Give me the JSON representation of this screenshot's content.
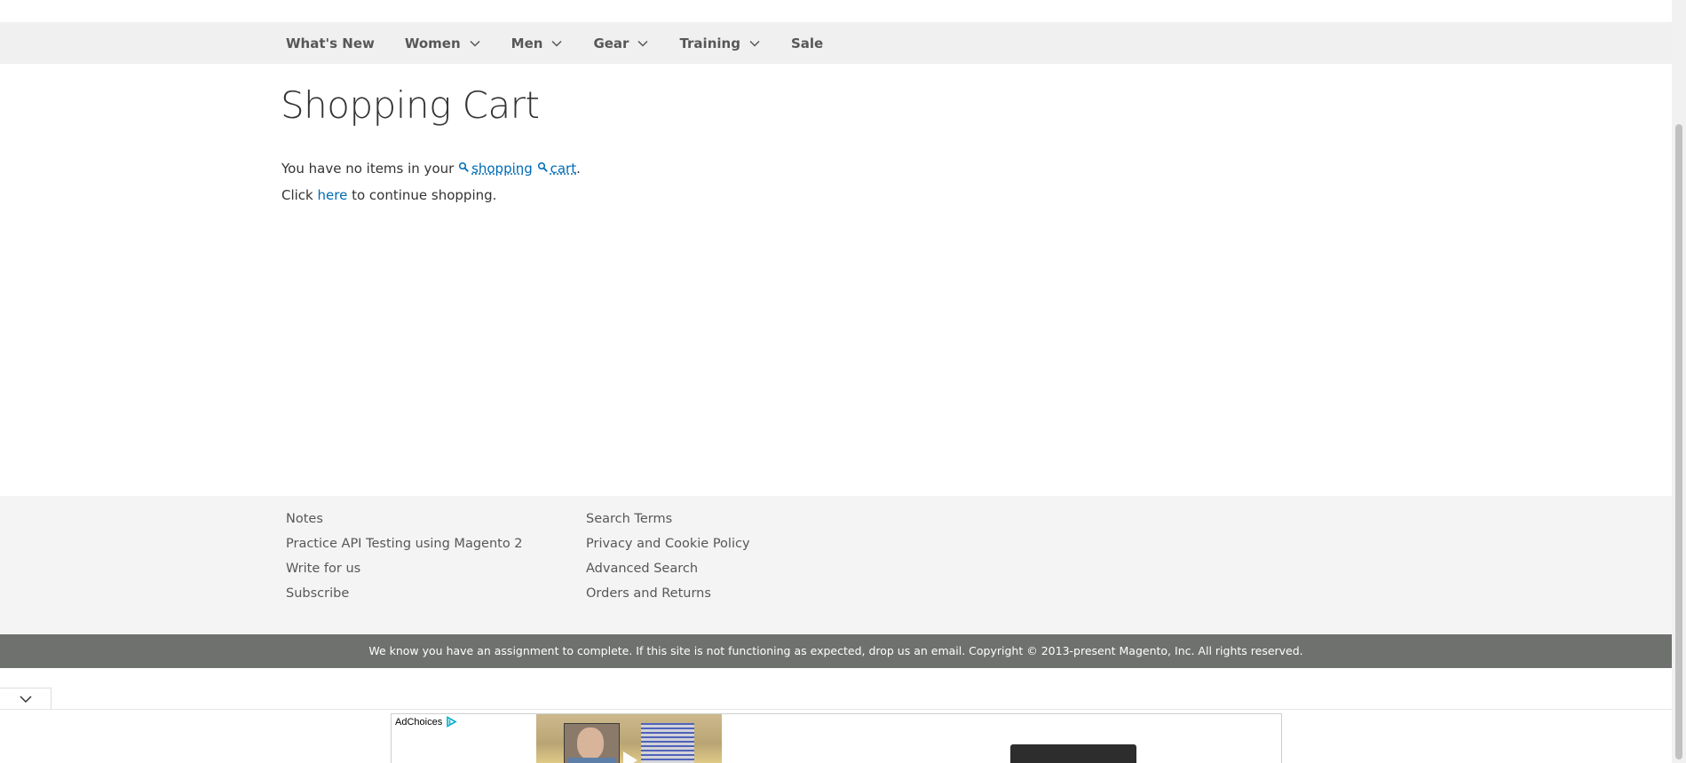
{
  "nav": {
    "items": [
      {
        "label": "What's New",
        "has_dropdown": false
      },
      {
        "label": "Women",
        "has_dropdown": true
      },
      {
        "label": "Men",
        "has_dropdown": true
      },
      {
        "label": "Gear",
        "has_dropdown": true
      },
      {
        "label": "Training",
        "has_dropdown": true
      },
      {
        "label": "Sale",
        "has_dropdown": false
      }
    ]
  },
  "main": {
    "title": "Shopping Cart",
    "empty_prefix": "You have no items in your ",
    "empty_word1": "shopping",
    "empty_word2": "cart",
    "empty_suffix": ".",
    "continue_prefix": "Click ",
    "continue_link": "here",
    "continue_suffix": " to continue shopping."
  },
  "footer": {
    "col1": [
      "Notes",
      "Practice API Testing using Magento 2",
      "Write for us",
      "Subscribe"
    ],
    "col2": [
      "Search Terms",
      "Privacy and Cookie Policy",
      "Advanced Search",
      "Orders and Returns"
    ],
    "copyright": "We know you have an assignment to complete. If this site is not functioning as expected, drop us an email. Copyright © 2013-present Magento, Inc. All rights reserved."
  },
  "ad": {
    "adchoices_label": "AdChoices"
  },
  "colors": {
    "link": "#006bb4",
    "nav_bg": "#f0f0f0",
    "footer_bg": "#f4f4f4",
    "copyright_bg": "#6e716e"
  },
  "icons": {
    "nav_dropdown": "chevron-down-icon",
    "search_highlight": "search-icon",
    "ad_collapse": "chevron-down-icon",
    "adchoices": "adchoices-icon"
  }
}
